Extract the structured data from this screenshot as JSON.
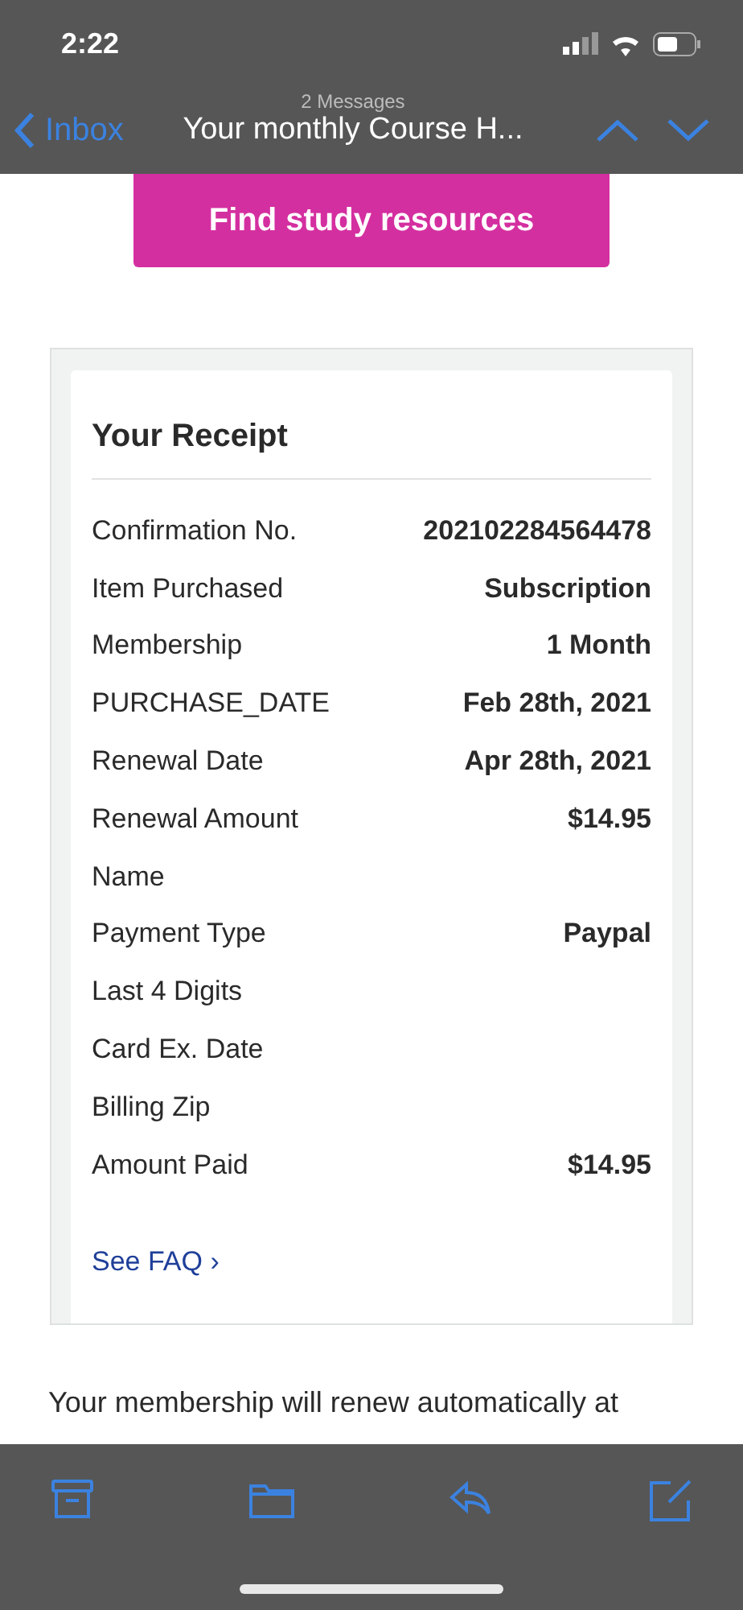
{
  "status_bar": {
    "time": "2:22"
  },
  "nav": {
    "back_label": "Inbox",
    "count": "2 Messages",
    "subject": "Your monthly Course H..."
  },
  "cta_button": {
    "label": "Find study resources"
  },
  "receipt": {
    "title": "Your Receipt",
    "rows": [
      {
        "label": "Confirmation No.",
        "value": "202102284564478"
      },
      {
        "label": "Item Purchased",
        "value": "Subscription"
      },
      {
        "label": "Membership",
        "value": "1 Month"
      },
      {
        "label": "PURCHASE_DATE",
        "value": "Feb 28th, 2021"
      },
      {
        "label": "Renewal Date",
        "value": "Apr 28th, 2021"
      },
      {
        "label": "Renewal Amount",
        "value": "$14.95"
      },
      {
        "label": "Name"
      },
      {
        "label": "Payment Type",
        "value": "Paypal"
      },
      {
        "label": "Last 4 Digits"
      },
      {
        "label": "Card Ex. Date"
      },
      {
        "label": "Billing Zip"
      },
      {
        "label": "Amount Paid",
        "value": "$14.95"
      }
    ],
    "faq_link": "See FAQ ›"
  },
  "body_text": "Your membership will renew automatically at",
  "toolbar": [
    {
      "kind": "archive"
    },
    {
      "kind": "folder"
    },
    {
      "kind": "reply"
    },
    {
      "kind": "compose"
    }
  ]
}
